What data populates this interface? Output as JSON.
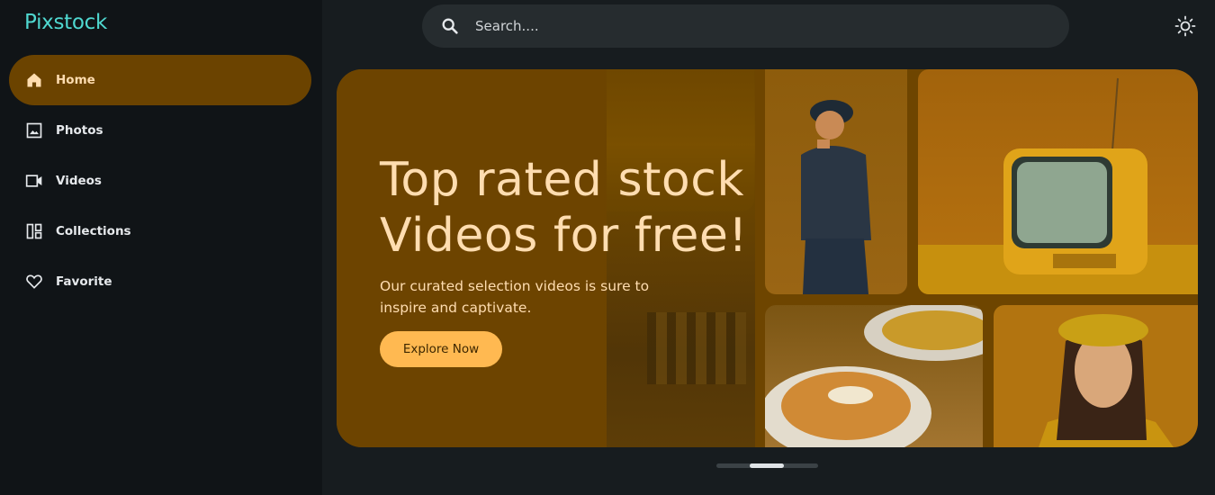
{
  "app": {
    "name": "Pixstock"
  },
  "sidebar": {
    "items": [
      {
        "label": "Home",
        "icon": "home-icon",
        "active": true
      },
      {
        "label": "Photos",
        "icon": "image-icon",
        "active": false
      },
      {
        "label": "Videos",
        "icon": "video-camera-icon",
        "active": false
      },
      {
        "label": "Collections",
        "icon": "collections-icon",
        "active": false
      },
      {
        "label": "Favorite",
        "icon": "heart-icon",
        "active": false
      }
    ]
  },
  "search": {
    "placeholder": "Search....",
    "value": ""
  },
  "header": {
    "theme_toggle_icon": "sun-icon"
  },
  "hero": {
    "title_line1": "Top rated stock",
    "title_line2": "Videos for free!",
    "subtitle_line1": "Our curated selection videos is sure to",
    "subtitle_line2": "inspire and captivate.",
    "cta_label": "Explore Now"
  },
  "pager": {
    "slides": 3,
    "active": 1
  },
  "colors": {
    "accent": "#4fd8d0",
    "active_nav": "#6b4300",
    "cta": "#ffb951",
    "hero_bg": "#6e4500"
  }
}
